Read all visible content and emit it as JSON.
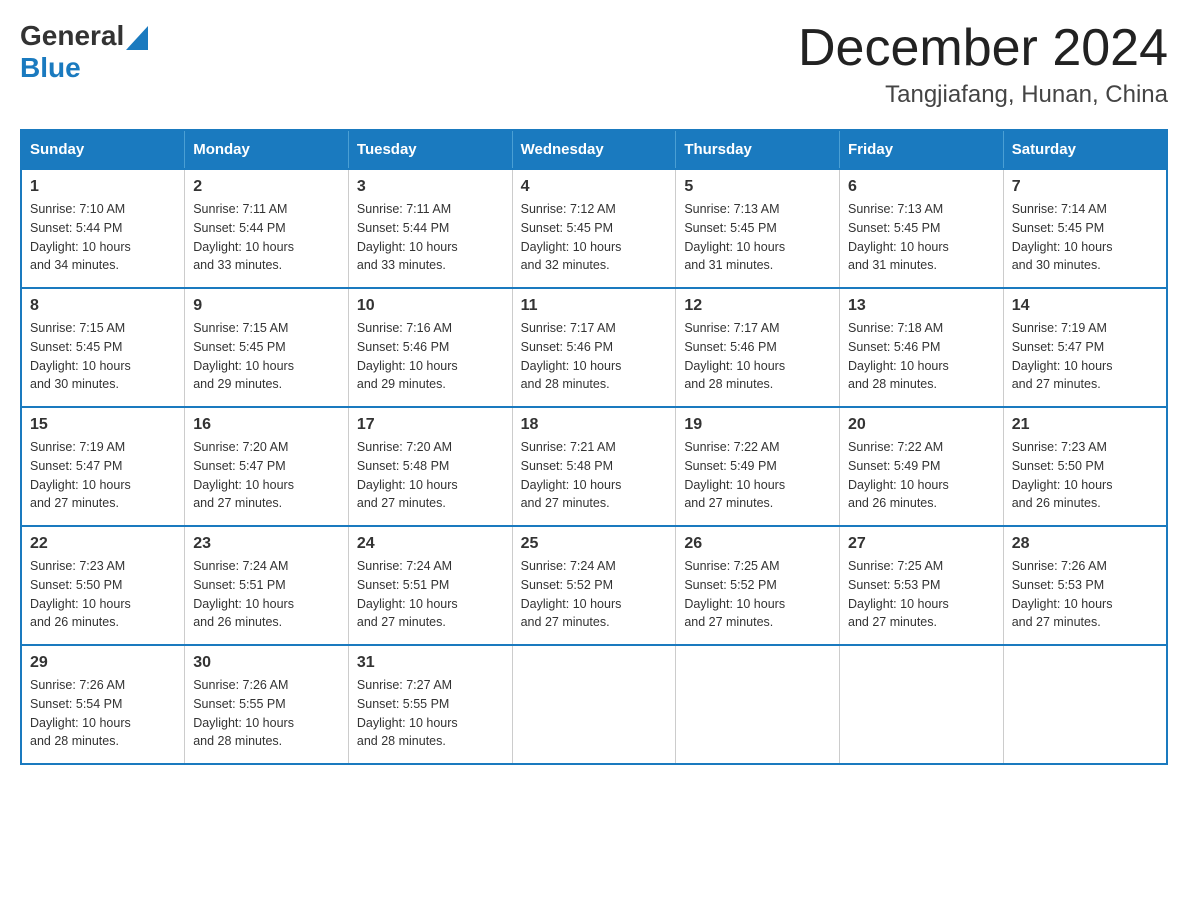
{
  "header": {
    "logo_general": "General",
    "logo_blue": "Blue",
    "title": "December 2024",
    "subtitle": "Tangjiafang, Hunan, China"
  },
  "days_of_week": [
    "Sunday",
    "Monday",
    "Tuesday",
    "Wednesday",
    "Thursday",
    "Friday",
    "Saturday"
  ],
  "weeks": [
    [
      {
        "day": "1",
        "info": "Sunrise: 7:10 AM\nSunset: 5:44 PM\nDaylight: 10 hours\nand 34 minutes."
      },
      {
        "day": "2",
        "info": "Sunrise: 7:11 AM\nSunset: 5:44 PM\nDaylight: 10 hours\nand 33 minutes."
      },
      {
        "day": "3",
        "info": "Sunrise: 7:11 AM\nSunset: 5:44 PM\nDaylight: 10 hours\nand 33 minutes."
      },
      {
        "day": "4",
        "info": "Sunrise: 7:12 AM\nSunset: 5:45 PM\nDaylight: 10 hours\nand 32 minutes."
      },
      {
        "day": "5",
        "info": "Sunrise: 7:13 AM\nSunset: 5:45 PM\nDaylight: 10 hours\nand 31 minutes."
      },
      {
        "day": "6",
        "info": "Sunrise: 7:13 AM\nSunset: 5:45 PM\nDaylight: 10 hours\nand 31 minutes."
      },
      {
        "day": "7",
        "info": "Sunrise: 7:14 AM\nSunset: 5:45 PM\nDaylight: 10 hours\nand 30 minutes."
      }
    ],
    [
      {
        "day": "8",
        "info": "Sunrise: 7:15 AM\nSunset: 5:45 PM\nDaylight: 10 hours\nand 30 minutes."
      },
      {
        "day": "9",
        "info": "Sunrise: 7:15 AM\nSunset: 5:45 PM\nDaylight: 10 hours\nand 29 minutes."
      },
      {
        "day": "10",
        "info": "Sunrise: 7:16 AM\nSunset: 5:46 PM\nDaylight: 10 hours\nand 29 minutes."
      },
      {
        "day": "11",
        "info": "Sunrise: 7:17 AM\nSunset: 5:46 PM\nDaylight: 10 hours\nand 28 minutes."
      },
      {
        "day": "12",
        "info": "Sunrise: 7:17 AM\nSunset: 5:46 PM\nDaylight: 10 hours\nand 28 minutes."
      },
      {
        "day": "13",
        "info": "Sunrise: 7:18 AM\nSunset: 5:46 PM\nDaylight: 10 hours\nand 28 minutes."
      },
      {
        "day": "14",
        "info": "Sunrise: 7:19 AM\nSunset: 5:47 PM\nDaylight: 10 hours\nand 27 minutes."
      }
    ],
    [
      {
        "day": "15",
        "info": "Sunrise: 7:19 AM\nSunset: 5:47 PM\nDaylight: 10 hours\nand 27 minutes."
      },
      {
        "day": "16",
        "info": "Sunrise: 7:20 AM\nSunset: 5:47 PM\nDaylight: 10 hours\nand 27 minutes."
      },
      {
        "day": "17",
        "info": "Sunrise: 7:20 AM\nSunset: 5:48 PM\nDaylight: 10 hours\nand 27 minutes."
      },
      {
        "day": "18",
        "info": "Sunrise: 7:21 AM\nSunset: 5:48 PM\nDaylight: 10 hours\nand 27 minutes."
      },
      {
        "day": "19",
        "info": "Sunrise: 7:22 AM\nSunset: 5:49 PM\nDaylight: 10 hours\nand 27 minutes."
      },
      {
        "day": "20",
        "info": "Sunrise: 7:22 AM\nSunset: 5:49 PM\nDaylight: 10 hours\nand 26 minutes."
      },
      {
        "day": "21",
        "info": "Sunrise: 7:23 AM\nSunset: 5:50 PM\nDaylight: 10 hours\nand 26 minutes."
      }
    ],
    [
      {
        "day": "22",
        "info": "Sunrise: 7:23 AM\nSunset: 5:50 PM\nDaylight: 10 hours\nand 26 minutes."
      },
      {
        "day": "23",
        "info": "Sunrise: 7:24 AM\nSunset: 5:51 PM\nDaylight: 10 hours\nand 26 minutes."
      },
      {
        "day": "24",
        "info": "Sunrise: 7:24 AM\nSunset: 5:51 PM\nDaylight: 10 hours\nand 27 minutes."
      },
      {
        "day": "25",
        "info": "Sunrise: 7:24 AM\nSunset: 5:52 PM\nDaylight: 10 hours\nand 27 minutes."
      },
      {
        "day": "26",
        "info": "Sunrise: 7:25 AM\nSunset: 5:52 PM\nDaylight: 10 hours\nand 27 minutes."
      },
      {
        "day": "27",
        "info": "Sunrise: 7:25 AM\nSunset: 5:53 PM\nDaylight: 10 hours\nand 27 minutes."
      },
      {
        "day": "28",
        "info": "Sunrise: 7:26 AM\nSunset: 5:53 PM\nDaylight: 10 hours\nand 27 minutes."
      }
    ],
    [
      {
        "day": "29",
        "info": "Sunrise: 7:26 AM\nSunset: 5:54 PM\nDaylight: 10 hours\nand 28 minutes."
      },
      {
        "day": "30",
        "info": "Sunrise: 7:26 AM\nSunset: 5:55 PM\nDaylight: 10 hours\nand 28 minutes."
      },
      {
        "day": "31",
        "info": "Sunrise: 7:27 AM\nSunset: 5:55 PM\nDaylight: 10 hours\nand 28 minutes."
      },
      null,
      null,
      null,
      null
    ]
  ]
}
